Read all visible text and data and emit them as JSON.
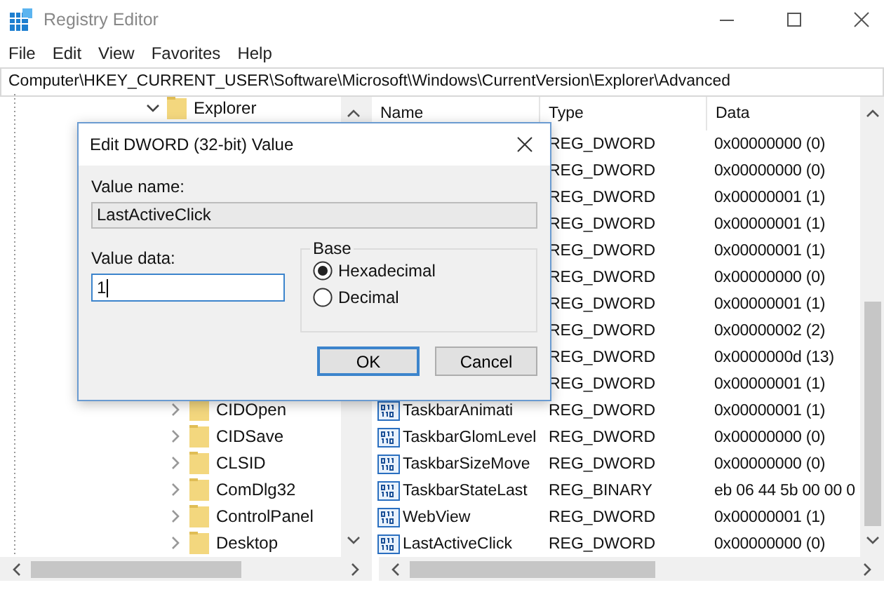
{
  "window": {
    "title": "Registry Editor"
  },
  "menu": [
    "File",
    "Edit",
    "View",
    "Favorites",
    "Help"
  ],
  "address": "Computer\\HKEY_CURRENT_USER\\Software\\Microsoft\\Windows\\CurrentVersion\\Explorer\\Advanced",
  "tree": [
    {
      "label": "Explorer",
      "expanded": true,
      "children": [
        {
          "label": "CIDOpen",
          "expanded": false
        },
        {
          "label": "CIDSave",
          "expanded": false
        },
        {
          "label": "CLSID",
          "expanded": false
        },
        {
          "label": "ComDlg32",
          "expanded": false
        },
        {
          "label": "ControlPanel",
          "expanded": false
        },
        {
          "label": "Desktop",
          "expanded": false
        }
      ]
    }
  ],
  "table": {
    "columns": [
      "Name",
      "Type",
      "Data"
    ],
    "rows": [
      {
        "type": "REG_DWORD",
        "data": "0x00000000 (0)"
      },
      {
        "type": "REG_DWORD",
        "data": "0x00000000 (0)"
      },
      {
        "type": "REG_DWORD",
        "data": "0x00000001 (1)"
      },
      {
        "type": "REG_DWORD",
        "data": "0x00000001 (1)"
      },
      {
        "type": "REG_DWORD",
        "data": "0x00000001 (1)"
      },
      {
        "type": "REG_DWORD",
        "data": "0x00000000 (0)"
      },
      {
        "type": "REG_DWORD",
        "data": "0x00000001 (1)"
      },
      {
        "type": "REG_DWORD",
        "data": "0x00000002 (2)"
      },
      {
        "type": "REG_DWORD",
        "data": "0x0000000d (13)"
      },
      {
        "type": "REG_DWORD",
        "data": "0x00000001 (1)"
      },
      {
        "name": "TaskbarAnimati",
        "type": "REG_DWORD",
        "data": "0x00000001 (1)"
      },
      {
        "name": "TaskbarGlomLevel",
        "type": "REG_DWORD",
        "data": "0x00000000 (0)"
      },
      {
        "name": "TaskbarSizeMove",
        "type": "REG_DWORD",
        "data": "0x00000000 (0)"
      },
      {
        "name": "TaskbarStateLast",
        "type": "REG_BINARY",
        "data": "eb 06 44 5b 00 00 0"
      },
      {
        "name": "WebView",
        "type": "REG_DWORD",
        "data": "0x00000001 (1)"
      },
      {
        "name": "LastActiveClick",
        "type": "REG_DWORD",
        "data": "0x00000000 (0)"
      }
    ]
  },
  "dialog": {
    "title": "Edit DWORD (32-bit) Value",
    "value_name_label": "Value name:",
    "value_name": "LastActiveClick",
    "value_data_label": "Value data:",
    "value_data": "1",
    "base_label": "Base",
    "bases": [
      {
        "label": "Hexadecimal",
        "selected": true
      },
      {
        "label": "Decimal",
        "selected": false
      }
    ],
    "buttons": [
      {
        "label": "OK",
        "default": true
      },
      {
        "label": "Cancel",
        "default": false
      }
    ]
  }
}
